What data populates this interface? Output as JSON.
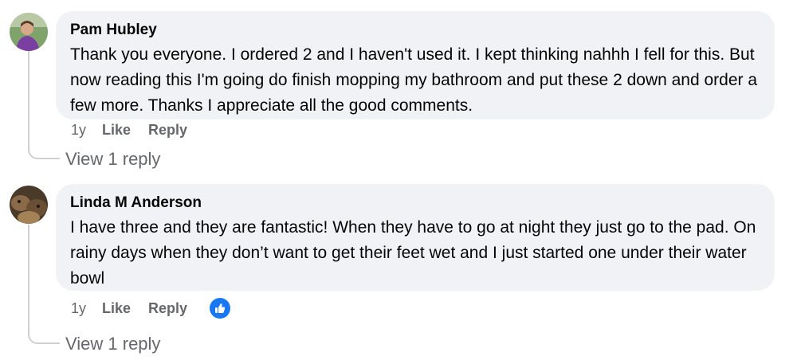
{
  "comments": [
    {
      "author": "Pam Hubley",
      "text": "Thank you everyone. I ordered 2 and I haven't used it. I kept thinking nahhh I fell for this. But now reading this I'm going do finish mopping my bathroom and put these 2 down and order a few more. Thanks I appreciate all the good comments.",
      "time": "1y",
      "like_label": "Like",
      "reply_label": "Reply",
      "view_replies": "View 1 reply"
    },
    {
      "author": "Linda M Anderson",
      "text": "I have three and they are fantastic! When they have to go at night they just go to the pad. On rainy days when they don’t want to get their feet wet and I just started one under their water bowl",
      "time": "1y",
      "like_label": "Like",
      "reply_label": "Reply",
      "reaction_icon": "thumbs-up-icon",
      "view_replies": "View 1 reply"
    }
  ],
  "colors": {
    "bubble": "#f0f2f5",
    "secondary_text": "#65676b",
    "like_blue": "#1877f2"
  }
}
